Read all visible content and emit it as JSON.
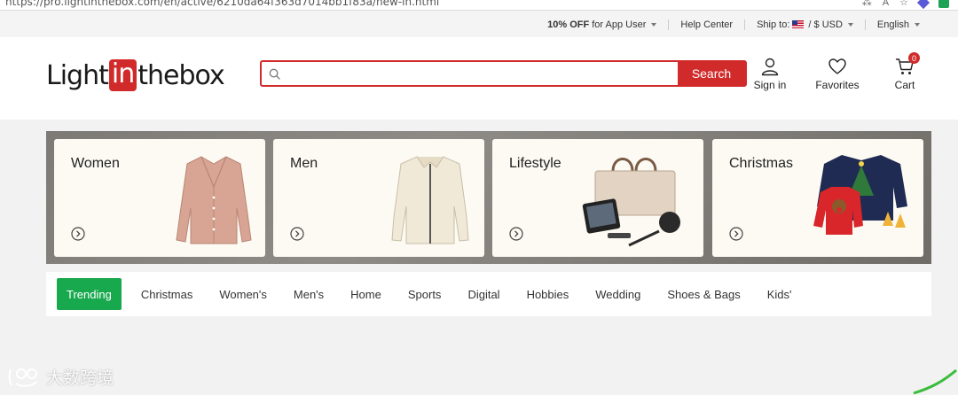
{
  "browser": {
    "url": "https://pro.lightinthebox.com/en/active/6210da64f363d7014bb1f83a/new-in.html"
  },
  "util_bar": {
    "promo_bold": "10% OFF",
    "promo_rest": "for App User",
    "help": "Help Center",
    "ship_label": "Ship to:",
    "currency": "/ $ USD",
    "language": "English"
  },
  "header": {
    "logo_left": "Light",
    "logo_mid": "in",
    "logo_right": "thebox",
    "search_placeholder": "",
    "search_button": "Search",
    "sign_in": "Sign in",
    "favorites": "Favorites",
    "cart": "Cart",
    "cart_count": "0"
  },
  "categories": [
    {
      "title": "Women"
    },
    {
      "title": "Men"
    },
    {
      "title": "Lifestyle"
    },
    {
      "title": "Christmas"
    }
  ],
  "tabs": [
    {
      "label": "Trending"
    },
    {
      "label": "Christmas"
    },
    {
      "label": "Women's"
    },
    {
      "label": "Men's"
    },
    {
      "label": "Home"
    },
    {
      "label": "Sports"
    },
    {
      "label": "Digital"
    },
    {
      "label": "Hobbies"
    },
    {
      "label": "Wedding"
    },
    {
      "label": "Shoes & Bags"
    },
    {
      "label": "Kids'"
    }
  ],
  "watermark": "大数跨境",
  "colors": {
    "brand_red": "#d12a2a",
    "trending_green": "#18a84e"
  }
}
